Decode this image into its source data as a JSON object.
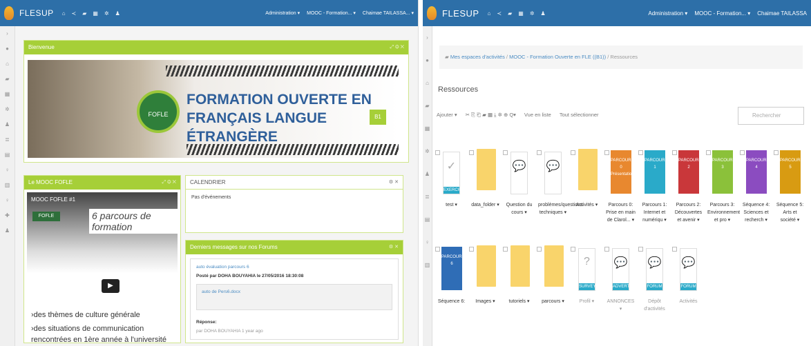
{
  "left_screen": {
    "topbar": {
      "brand": "FLESUP",
      "icons": [
        "home-icon",
        "share-icon",
        "folder-icon",
        "calendar-icon",
        "gear-icon",
        "user-icon"
      ],
      "menu": [
        "Administration ▾",
        "MOOC - Formation... ▾",
        "Chaimae TAILASSA... ▾"
      ]
    },
    "welcome_panel": {
      "header": "Bienvenue",
      "banner": {
        "badge": "FOFLE",
        "title_line1": "FORMATION OUVERTE EN",
        "title_line2": "FRANÇAIS LANGUE ÉTRANGÈRE",
        "level": "B1"
      }
    },
    "mooc_panel": {
      "header": "Le MOOC FOFLE",
      "video": {
        "title": "MOOC FOFLE #1",
        "headline": "6 parcours de formation",
        "logo": "FOFLE",
        "line1": "›des thèmes de culture générale",
        "line2": "›des situations de communication",
        "line3": "rencontrées en 1ère année à l'université"
      }
    },
    "calendar_panel": {
      "header": "CALENDRIER",
      "empty_text": "Pas d'événements"
    },
    "forum_panel": {
      "header": "Derniers messages sur nos Forums",
      "topic": "auto évaluation parcours 6",
      "posted_by": "Posté par DOHA BOUYAHIA le 27/05/2016 18:30:08",
      "attachment": "auto de Pers6.docx",
      "replies_label": "Réponse:",
      "reply_meta": "par DOHA BOUYAHIA 1 year ago"
    }
  },
  "right_screen": {
    "topbar": {
      "brand": "FLESUP",
      "menu": [
        "Administration ▾",
        "MOOC - Formation... ▾",
        "Chaimae TAILASSA"
      ]
    },
    "breadcrumb": {
      "items": [
        "Mes espaces d'activités",
        "MOOC - Formation Ouverte en FLE ((B1))",
        "Ressources"
      ]
    },
    "page_title": "Ressources",
    "toolbar": {
      "add": "Ajouter ▾",
      "list_view": "Vue en liste",
      "select_all": "Tout sélectionner"
    },
    "search_placeholder": "Rechercher",
    "resources_row1": [
      {
        "label": "test ▾",
        "kind": "exercise",
        "tag": "EXERCICE"
      },
      {
        "label": "data_folder ▾",
        "kind": "folder"
      },
      {
        "label": "Question du cours ▾",
        "kind": "forum-doc"
      },
      {
        "label": "problèmes/questions techniques ▾",
        "kind": "forum-doc"
      },
      {
        "label": "Activités ▾",
        "kind": "folder"
      },
      {
        "label": "Parcours 0: Prise en main de Clarol... ▾",
        "kind": "parcours",
        "title": "PARCOURS 0 Présentation",
        "color": "#e8882f"
      },
      {
        "label": "Parcours 1: Internet et numériqu ▾",
        "kind": "parcours",
        "title": "PARCOURS 1",
        "color": "#2aaac9"
      },
      {
        "label": "Parcours 2: Découvertes et avenir ▾",
        "kind": "parcours",
        "title": "PARCOURS 2",
        "color": "#c9373a"
      },
      {
        "label": "Parcours 3: Environnement et pro ▾",
        "kind": "parcours",
        "title": "PARCOURS 3",
        "color": "#8bc13a"
      },
      {
        "label": "Séquence 4: Sciences et recherch ▾",
        "kind": "parcours",
        "title": "PARCOURS 4",
        "color": "#8b4cc0"
      },
      {
        "label": "Séquence 5: Arts et société ▾",
        "kind": "parcours",
        "title": "PARCOURS 5",
        "color": "#d89b12"
      }
    ],
    "resources_row2": [
      {
        "label": "Séquence 6:",
        "kind": "parcours",
        "title": "PARCOURS 6",
        "color": "#2f6db6"
      },
      {
        "label": "Images ▾",
        "kind": "folder"
      },
      {
        "label": "tutoriels ▾",
        "kind": "folder"
      },
      {
        "label": "parcours ▾",
        "kind": "folder"
      },
      {
        "label": "Profil ▾",
        "kind": "survey",
        "tag": "SURVEY"
      },
      {
        "label": "ANNONCES ▾",
        "kind": "advert",
        "tag": "ADVERT"
      },
      {
        "label": "Dépôt d'activités",
        "kind": "forum",
        "tag": "FORUM"
      },
      {
        "label": "Activités",
        "kind": "forum",
        "tag": "FORUM"
      }
    ]
  }
}
